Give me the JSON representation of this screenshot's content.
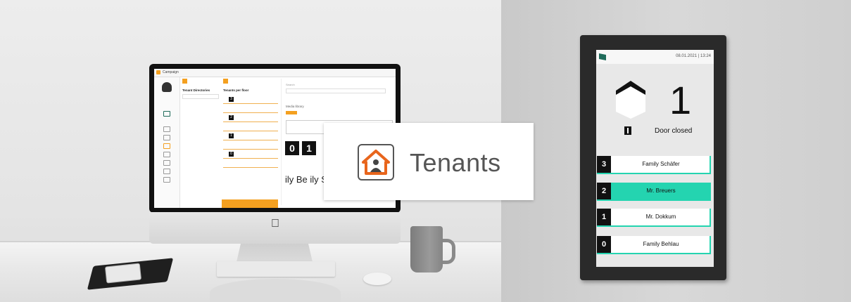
{
  "scene": {
    "colors": {
      "accent_orange": "#f4a020",
      "accent_teal": "#24d4b0",
      "dark": "#111111"
    }
  },
  "monitor": {
    "app_title": "Campaign",
    "sidebar_label": "Tenant Directories",
    "list_title": "Tenants per floor",
    "section_label": "Media library",
    "search_placeholder": "Search",
    "tiles": [
      "0",
      "1"
    ],
    "partial_text": "ily Be ily S"
  },
  "callout": {
    "icon": "house-person-icon",
    "label": "Tenants"
  },
  "tablet": {
    "date_time": "08.01.2021 | 13:24",
    "current_floor": "1",
    "arrow_icon": "elevator-up-arrow-icon",
    "door_status": "Door closed",
    "floors": [
      {
        "number": "3",
        "name": "Family Schäfer",
        "active": false
      },
      {
        "number": "2",
        "name": "Mr. Breuers",
        "active": true
      },
      {
        "number": "1",
        "name": "Mr. Dokkum",
        "active": false
      },
      {
        "number": "0",
        "name": "Family Behlau",
        "active": false
      }
    ]
  }
}
